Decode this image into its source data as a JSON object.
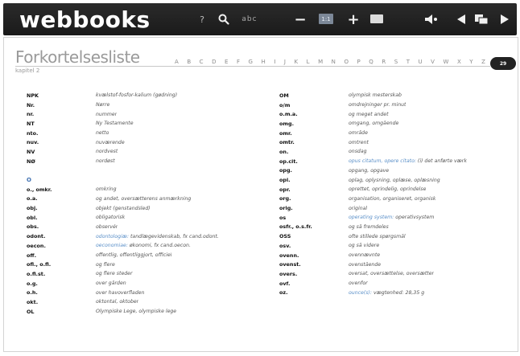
{
  "toolbar": {
    "logo": "webbooks",
    "help": "?",
    "abc": "abc",
    "minus": "−",
    "zoom": "1:1",
    "plus": "+"
  },
  "page": {
    "title": "Forkortelsesliste",
    "subtitle": "kapitel 2",
    "page_number": "29"
  },
  "alphabet": [
    "A",
    "B",
    "C",
    "D",
    "E",
    "F",
    "G",
    "H",
    "I",
    "J",
    "K",
    "L",
    "M",
    "N",
    "O",
    "P",
    "Q",
    "R",
    "S",
    "T",
    "U",
    "V",
    "W",
    "X",
    "Y",
    "Z"
  ],
  "left_column": [
    {
      "abbr": "NPK",
      "def": "kvælstof-fosfor-kalium (gødning)"
    },
    {
      "abbr": "Nr.",
      "def": "Nørre"
    },
    {
      "abbr": "nr.",
      "def": "nummer"
    },
    {
      "abbr": "NT",
      "def": "Ny Testamente"
    },
    {
      "abbr": "nto.",
      "def": "netto"
    },
    {
      "abbr": "nuv.",
      "def": "nuværende"
    },
    {
      "abbr": "NV",
      "def": "nordvest"
    },
    {
      "abbr": "NØ",
      "def": "nordøst"
    },
    {
      "abbr": "",
      "def": ""
    },
    {
      "abbr": "O",
      "def": "",
      "section": true
    },
    {
      "abbr": "o., omkr.",
      "def": "omkring"
    },
    {
      "abbr": "o.a.",
      "def": "og andet, oversætterens anmærkning"
    },
    {
      "abbr": "obj.",
      "def": "objekt (genstandsled)"
    },
    {
      "abbr": "obl.",
      "def": "obligatorisk"
    },
    {
      "abbr": "obs.",
      "def": "observér"
    },
    {
      "abbr": "odont.",
      "def": "tandlægevidenskab, fx cand.odont.",
      "link": "odontologiæ:"
    },
    {
      "abbr": "oecon.",
      "def": "økonomi, fx cand.oecon.",
      "link": "oeconomiae:"
    },
    {
      "abbr": "off.",
      "def": "offentlig, offentliggjort, officiel"
    },
    {
      "abbr": "ofl., o.fl.",
      "def": "og flere"
    },
    {
      "abbr": "o.fl.st.",
      "def": "og flere steder"
    },
    {
      "abbr": "o.g.",
      "def": "over gården"
    },
    {
      "abbr": "o.h.",
      "def": "over havoverfladen"
    },
    {
      "abbr": "okt.",
      "def": "oktontal, oktober"
    },
    {
      "abbr": "OL",
      "def": "Olympiske Lege, olympiske lege"
    }
  ],
  "right_column": [
    {
      "abbr": "OM",
      "def": "olympisk mesterskab"
    },
    {
      "abbr": "o/m",
      "def": "omdrejninger pr. minut"
    },
    {
      "abbr": "o.m.a.",
      "def": "og meget andet"
    },
    {
      "abbr": "omg.",
      "def": "omgang, omgående"
    },
    {
      "abbr": "omr.",
      "def": "område"
    },
    {
      "abbr": "omtr.",
      "def": "omtrent"
    },
    {
      "abbr": "on.",
      "def": "onsdag"
    },
    {
      "abbr": "op.cit.",
      "def": "(i) det anførte værk",
      "link": "opus citatum, opere citato:"
    },
    {
      "abbr": "opg.",
      "def": "opgang, opgave"
    },
    {
      "abbr": "opl.",
      "def": "oplag, oplysning, oplæse, oplæsning"
    },
    {
      "abbr": "opr.",
      "def": "oprettet, oprindelig, oprindelse"
    },
    {
      "abbr": "org.",
      "def": "organisation, organiseret, organisk"
    },
    {
      "abbr": "orig.",
      "def": "original"
    },
    {
      "abbr": "os",
      "def": "operativsystem",
      "link": "operating system:"
    },
    {
      "abbr": "osfr., o.s.fr.",
      "def": "og så fremdeles"
    },
    {
      "abbr": "OSS",
      "def": "ofte stillede spørgsmål"
    },
    {
      "abbr": "osv.",
      "def": "og så videre"
    },
    {
      "abbr": "ovenn.",
      "def": "ovennævnte"
    },
    {
      "abbr": "ovenst.",
      "def": "ovenstående"
    },
    {
      "abbr": "overs.",
      "def": "oversat, oversættelse, oversætter"
    },
    {
      "abbr": "ovf.",
      "def": "ovenfor"
    },
    {
      "abbr": "oz.",
      "def": "vægtenhed: 28,35 g",
      "link": "ounce(s):"
    }
  ],
  "colors": {
    "toolbar": "#1f1f1f",
    "link": "#5a8fc8",
    "section": "#3d6fb0",
    "page_tab": "#222222"
  }
}
